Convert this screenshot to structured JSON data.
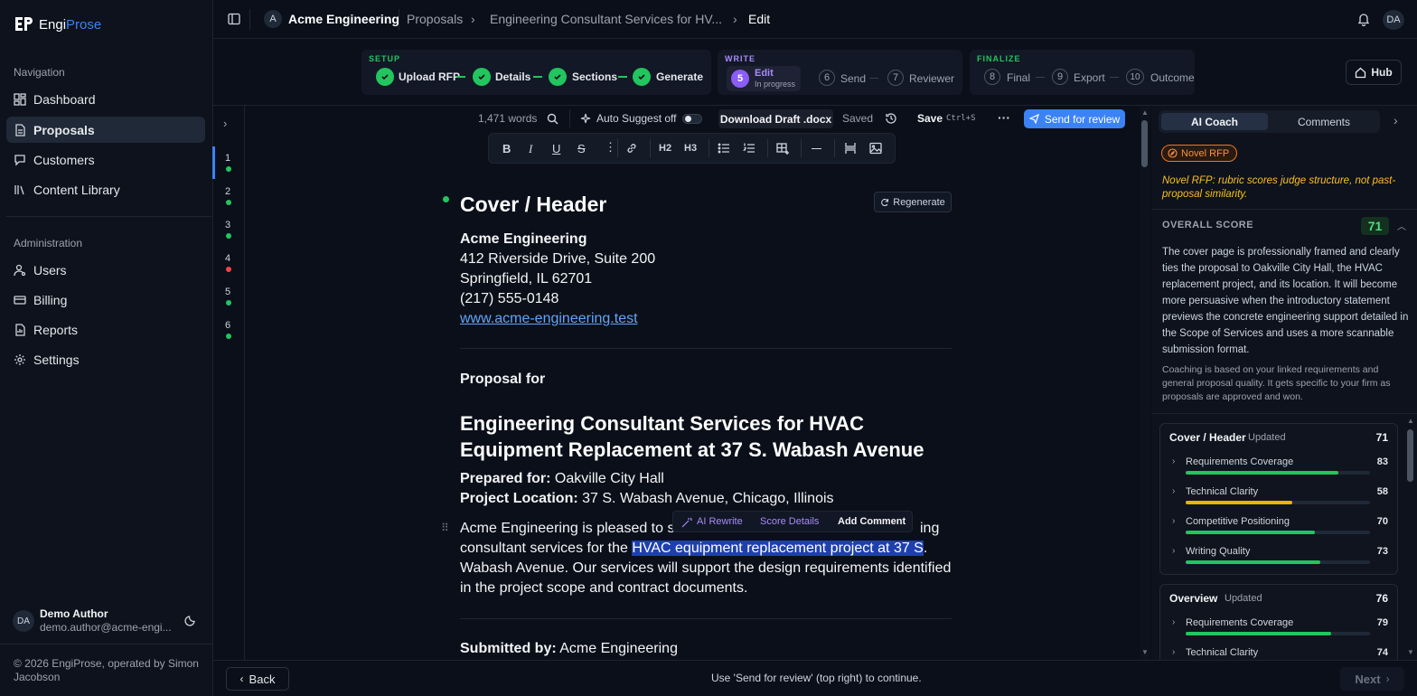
{
  "app": {
    "name_part1": "Engi",
    "name_part2": "Prose"
  },
  "sidebar": {
    "nav_heading": "Navigation",
    "nav_items": [
      {
        "label": "Dashboard",
        "icon": "dashboard-icon"
      },
      {
        "label": "Proposals",
        "icon": "document-icon",
        "active": true
      },
      {
        "label": "Customers",
        "icon": "chat-icon"
      },
      {
        "label": "Content Library",
        "icon": "library-icon"
      }
    ],
    "admin_heading": "Administration",
    "admin_items": [
      {
        "label": "Users",
        "icon": "users-icon"
      },
      {
        "label": "Billing",
        "icon": "billing-icon"
      },
      {
        "label": "Reports",
        "icon": "reports-icon"
      },
      {
        "label": "Settings",
        "icon": "gear-icon"
      }
    ],
    "user": {
      "initials": "DA",
      "name": "Demo Author",
      "email": "demo.author@acme-engi..."
    },
    "copyright": "© 2026 EngiProse, operated by Simon Jacobson"
  },
  "topbar": {
    "org_initial": "A",
    "org": "Acme Engineering",
    "crumb1": "Proposals",
    "crumb2": "Engineering Consultant Services for HV...",
    "crumb3": "Edit",
    "user_initials": "DA"
  },
  "stepper": {
    "setup_label": "SETUP",
    "write_label": "WRITE",
    "finalize_label": "FINALIZE",
    "setup_steps": [
      "Upload RFP",
      "Details",
      "Sections",
      "Generate"
    ],
    "edit": {
      "num": "5",
      "label": "Edit",
      "status": "In progress"
    },
    "write_steps": [
      {
        "num": "6",
        "label": "Send"
      },
      {
        "num": "7",
        "label": "Reviewer"
      }
    ],
    "finalize_steps": [
      {
        "num": "8",
        "label": "Final"
      },
      {
        "num": "9",
        "label": "Export"
      },
      {
        "num": "10",
        "label": "Outcome"
      }
    ],
    "hub_label": "Hub"
  },
  "toolbar": {
    "word_count": "1,471 words",
    "auto_suggest": "Auto Suggest off",
    "download": "Download Draft .docx",
    "saved": "Saved",
    "save": "Save",
    "save_shortcut": "Ctrl+S",
    "send": "Send for review",
    "format": {
      "h2": "H2",
      "h3": "H3"
    }
  },
  "rail": {
    "sections": [
      {
        "num": "1",
        "status": "green"
      },
      {
        "num": "2",
        "status": "green"
      },
      {
        "num": "3",
        "status": "green"
      },
      {
        "num": "4",
        "status": "red"
      },
      {
        "num": "5",
        "status": "green"
      },
      {
        "num": "6",
        "status": "green"
      }
    ]
  },
  "doc": {
    "section_title": "Cover / Header",
    "regenerate": "Regenerate",
    "company": "Acme Engineering",
    "address1": "412 Riverside Drive, Suite 200",
    "address2": "Springfield, IL 62701",
    "phone": "(217) 555-0148",
    "website": "www.acme-engineering.test",
    "proposal_for": "Proposal for",
    "title_line1": "Engineering Consultant Services for HVAC",
    "title_line2": "Equipment Replacement at 37 S. Wabash Avenue",
    "prepared_label": "Prepared for:",
    "prepared_value": "Oakville City Hall",
    "location_label": "Project Location:",
    "location_value": "37 S. Wabash Avenue, Chicago, Illinois",
    "para_line1": "Acme Engineering is pleased to su",
    "para_line1_end": "ing",
    "para_line2_start": "consultant services for the ",
    "para_line2_highlight": "HVAC equipment replacement project at 37 S",
    "para_line2_end": ".",
    "para_line3": "Wabash Avenue. Our services will support the design requirements identified",
    "para_line4": "in the project scope and contract documents.",
    "submitted_label": "Submitted by:",
    "submitted_value": "Acme Engineering",
    "popover": {
      "ai_rewrite": "AI Rewrite",
      "score_details": "Score Details",
      "add_comment": "Add Comment"
    }
  },
  "coach": {
    "tab_coach": "AI Coach",
    "tab_comments": "Comments",
    "badge": "Novel RFP",
    "note": "Novel RFP: rubric scores judge structure, not past-proposal similarity.",
    "overall_label": "OVERALL SCORE",
    "overall_score": "71",
    "summary": "The cover page is professionally framed and clearly ties the proposal to Oakville City Hall, the HVAC replacement project, and its location. It will become more persuasive when the introductory statement previews the concrete engineering support detailed in the Scope of Services and uses a more scannable submission format.",
    "disclaimer": "Coaching is based on your linked requirements and general proposal quality. It gets specific to your firm as proposals are approved and won.",
    "cards": [
      {
        "title": "Cover / Header",
        "tag": "Updated",
        "score": "71",
        "metrics": [
          {
            "label": "Requirements Coverage",
            "value": "83",
            "color": "#22c55e"
          },
          {
            "label": "Technical Clarity",
            "value": "58",
            "color": "#eab308"
          },
          {
            "label": "Competitive Positioning",
            "value": "70",
            "color": "#22c55e"
          },
          {
            "label": "Writing Quality",
            "value": "73",
            "color": "#22c55e"
          }
        ]
      },
      {
        "title": "Overview",
        "tag": "Updated",
        "score": "76",
        "metrics": [
          {
            "label": "Requirements Coverage",
            "value": "79",
            "color": "#22c55e"
          },
          {
            "label": "Technical Clarity",
            "value": "74",
            "color": "#22c55e"
          }
        ]
      }
    ]
  },
  "footer": {
    "back": "Back",
    "hint": "Use 'Send for review' (top right) to continue.",
    "next": "Next"
  }
}
